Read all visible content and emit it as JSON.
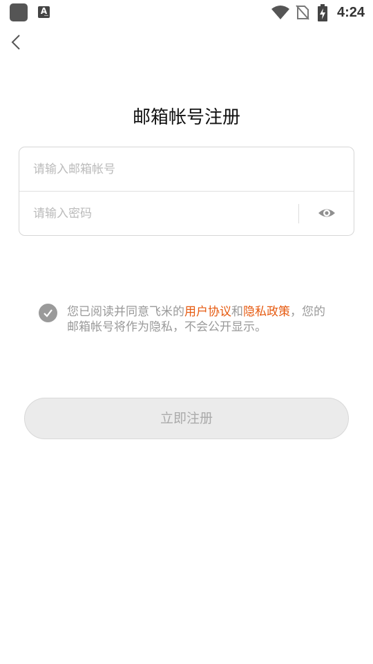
{
  "status_bar": {
    "time": "4:24",
    "icons": [
      "app-square-icon",
      "a-text-icon",
      "wifi-icon",
      "no-sim-icon",
      "battery-charging-icon"
    ],
    "a_icon_label": "A"
  },
  "header": {
    "back_icon": "chevron-left-icon",
    "title": "邮箱帐号注册"
  },
  "form": {
    "email": {
      "placeholder": "请输入邮箱帐号",
      "value": ""
    },
    "password": {
      "placeholder": "请输入密码",
      "value": ""
    },
    "visibility_icon": "eye-icon"
  },
  "agreement": {
    "checked": true,
    "prefix": "您已阅读并同意飞米的",
    "user_agreement": "用户协议",
    "and": "和",
    "privacy_policy": "隐私政策",
    "suffix": "，您的邮箱帐号将作为隐私，不会公开显示。"
  },
  "register_button": {
    "label": "立即注册"
  },
  "colors": {
    "accent_link": "#e65a10",
    "button_bg": "#ebebeb",
    "button_text": "#aaaaaa",
    "check_bg": "#9a9a9a"
  }
}
